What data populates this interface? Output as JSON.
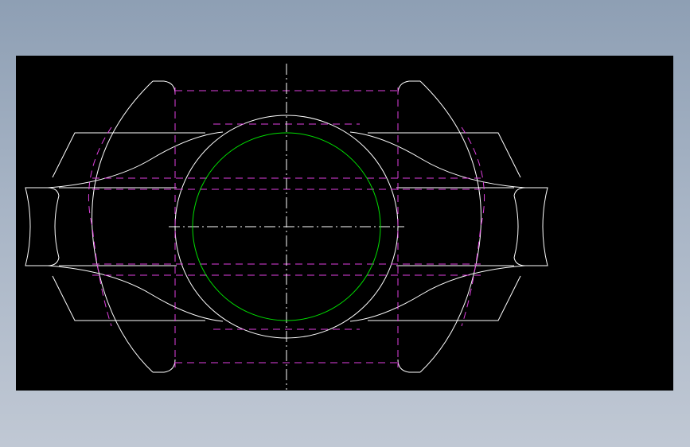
{
  "viewport": {
    "background": "#000000"
  },
  "colors": {
    "outline": "#ffffff",
    "hidden_line": "#e040e0",
    "circle": "#00e000",
    "centerline": "#ffffff"
  },
  "layers": [
    "outline",
    "hidden-lines",
    "centerlines",
    "circle"
  ]
}
